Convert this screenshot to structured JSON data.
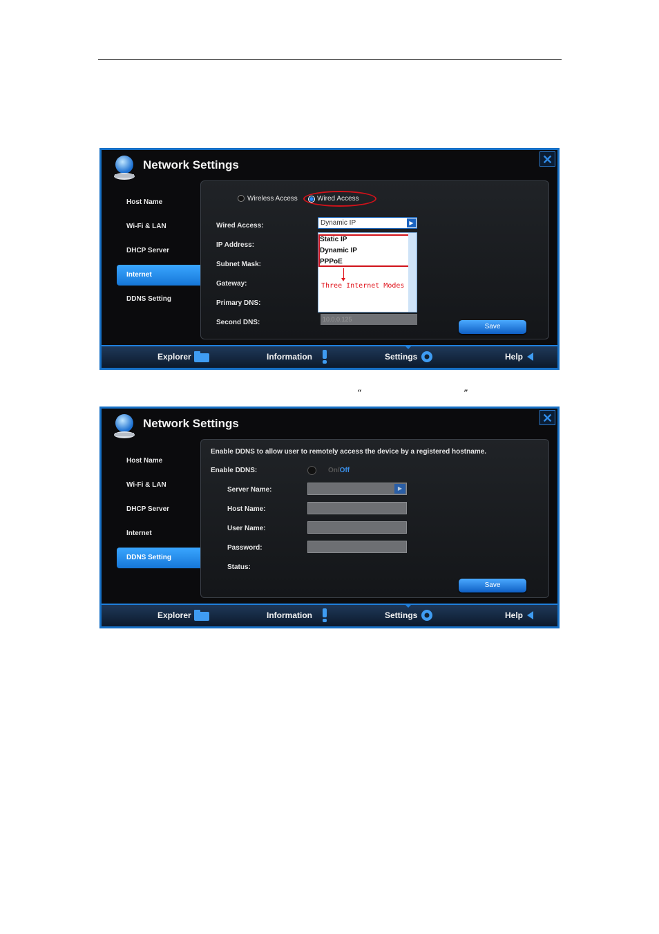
{
  "doc": {
    "quote_open": "“",
    "quote_close": "”"
  },
  "common": {
    "title": "Network Settings",
    "close_icon": "close-icon",
    "sidebar": [
      "Host Name",
      "Wi-Fi & LAN",
      "DHCP Server",
      "Internet",
      "DDNS Setting"
    ],
    "save_label": "Save",
    "bottom_nav": [
      {
        "label": "Explorer",
        "icon": "folder-icon"
      },
      {
        "label": "Information",
        "icon": "exclamation-icon"
      },
      {
        "label": "Settings",
        "icon": "gear-icon"
      },
      {
        "label": "Help",
        "icon": "back-arrow-icon"
      }
    ],
    "accent": "#1670c6"
  },
  "internet": {
    "radio_wireless": "Wireless Access",
    "radio_wired": "Wired Access",
    "fields": [
      "Wired Access:",
      "IP Address:",
      "Subnet Mask:",
      "Gateway:",
      "Primary DNS:",
      "Second DNS:"
    ],
    "select_value": "Dynamic IP",
    "options": [
      "Static IP",
      "Dynamic IP",
      "PPPoE"
    ],
    "annotation": "Three Internet Modes",
    "second_dns_value": "10.0.0.125"
  },
  "ddns": {
    "description": "Enable DDNS to allow user to remotely access the device by a registered hostname.",
    "enable_label": "Enable DDNS:",
    "toggle_on": "On",
    "toggle_sep": "/",
    "toggle_off": "Off",
    "fields": [
      "Server Name:",
      "Host Name:",
      "User Name:",
      "Password:",
      "Status:"
    ]
  }
}
